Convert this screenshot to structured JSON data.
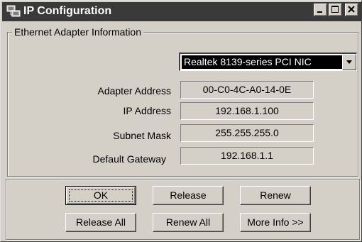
{
  "window": {
    "title": "IP Configuration",
    "icon": "network-computer-icon",
    "controls": [
      "minimize-icon",
      "maximize-icon",
      "close-icon"
    ]
  },
  "group": {
    "title": "Ethernet  Adapter Information"
  },
  "adapter": {
    "selected": "Realtek 8139-series PCI NIC"
  },
  "fields": {
    "adapter_address_label": "Adapter Address",
    "adapter_address": "00-C0-4C-A0-14-0E",
    "ip_address_label": "IP Address",
    "ip_address": "192.168.1.100",
    "subnet_mask_label": "Subnet Mask",
    "subnet_mask": "255.255.255.0",
    "default_gateway_label": "Default Gateway",
    "default_gateway": "192.168.1.1"
  },
  "buttons": {
    "ok": "OK",
    "release": "Release",
    "renew": "Renew",
    "release_all": "Release All",
    "renew_all": "Renew All",
    "more_info": "More Info >>"
  }
}
